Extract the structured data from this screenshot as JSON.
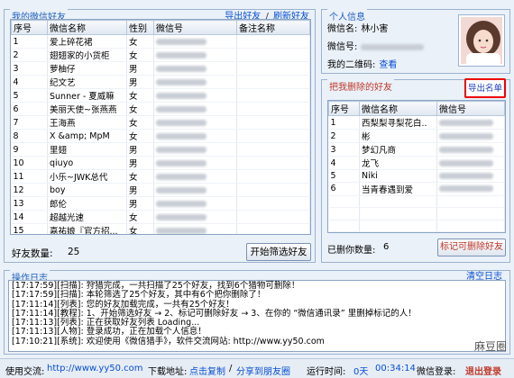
{
  "friends": {
    "title": "我的微信好友",
    "export_link": "导出好友",
    "sep": "/",
    "refresh_link": "刷新好友",
    "columns": [
      "序号",
      "微信名称",
      "性别",
      "微信号",
      "备注名称"
    ],
    "rows": [
      {
        "no": "1",
        "name": "爱上碎花裙",
        "gender": "女"
      },
      {
        "no": "2",
        "name": "翅翅家的小货柜",
        "gender": "女"
      },
      {
        "no": "3",
        "name": "萝柚仔",
        "gender": "男"
      },
      {
        "no": "4",
        "name": "纪文艺",
        "gender": "男"
      },
      {
        "no": "5",
        "name": "Sunner - 夏威嘛",
        "gender": "女"
      },
      {
        "no": "6",
        "name": "美丽天使~张燕燕",
        "gender": "女"
      },
      {
        "no": "7",
        "name": "王海燕",
        "gender": "女"
      },
      {
        "no": "8",
        "name": "X &amp; MpM",
        "gender": "女"
      },
      {
        "no": "9",
        "name": "里翅",
        "gender": "男"
      },
      {
        "no": "10",
        "name": "qiuyo",
        "gender": "男"
      },
      {
        "no": "11",
        "name": "小乐~JWK总代",
        "gender": "女"
      },
      {
        "no": "12",
        "name": "boy",
        "gender": "男"
      },
      {
        "no": "13",
        "name": "郎伦",
        "gender": "男"
      },
      {
        "no": "14",
        "name": "超越光速",
        "gender": "女"
      },
      {
        "no": "15",
        "name": "嘉祐娘『官方招...",
        "gender": "女"
      },
      {
        "no": "16",
        "name": "悠骆   招代理",
        "gender": "女"
      },
      {
        "no": "17",
        "name": "A 嗯空 久美诚...",
        "gender": "女"
      },
      {
        "no": "18",
        "name": "小妃",
        "gender": "女"
      },
      {
        "no": "19",
        "name": "张家明",
        "gender": "男"
      }
    ],
    "count_label": "好友数量:",
    "count_value": "25",
    "start_button": "开始筛选好友"
  },
  "personal": {
    "title": "个人信息",
    "nick_label": "微信名:",
    "nick_value": "林小害",
    "id_label": "微信号:",
    "qr_label": "我的二维码:",
    "qr_link": "查看"
  },
  "deleted": {
    "title": "把我删除的好友",
    "export_button": "导出名单",
    "columns": [
      "序号",
      "微信名称",
      "微信号"
    ],
    "rows": [
      {
        "no": "1",
        "name": "西梨梨寻梨花白.."
      },
      {
        "no": "2",
        "name": "彬"
      },
      {
        "no": "3",
        "name": "梦幻凡商"
      },
      {
        "no": "4",
        "name": "龙飞"
      },
      {
        "no": "5",
        "name": "Niki"
      },
      {
        "no": "6",
        "name": "当青春遇到爱"
      }
    ],
    "count_label": "已删你数量:",
    "count_value": "6",
    "mark_button": "标记可删除好友"
  },
  "log": {
    "title": "操作日志",
    "clear_link": "清空日志",
    "lines": [
      "[17:17:59][扫描]: 狩猎完成，一共扫描了25个好友，找到6个猎物可删除！",
      "[17:17:59][扫描]: 本轮筛选了25个好友，其中有6个把你删除了！",
      "[17:11:14][列表]: 您的好友加载完成，一共有25个好友！",
      "[17:11:14][教程]: 1、开始筛选好友 → 2、标记可删除好友 → 3、在你的 “微信通讯录” 里删掉标记的人！",
      "[17:11:13][列表]: 正在获取好友列表 Loading...",
      "[17:11:13][人物]: 登录成功，正在加载个人信息！",
      "[17:10:21][系统]: 欢迎使用《微信猎手》，软件交流网站: http://www.yy50.com"
    ]
  },
  "status": {
    "exchange_label": "使用交流:",
    "exchange_url": "http://www.yy50.com",
    "download_label": "下载地址:",
    "copy_link": "点击复制",
    "share_sep": "/",
    "share_link": "分享到朋友圈",
    "runtime_label": "运行时间:",
    "runtime_value": "0天",
    "runtime_clock": "00:34:14",
    "login_label": "微信登录:",
    "logout_link": "退出登录"
  },
  "watermark": "麻豆圈"
}
